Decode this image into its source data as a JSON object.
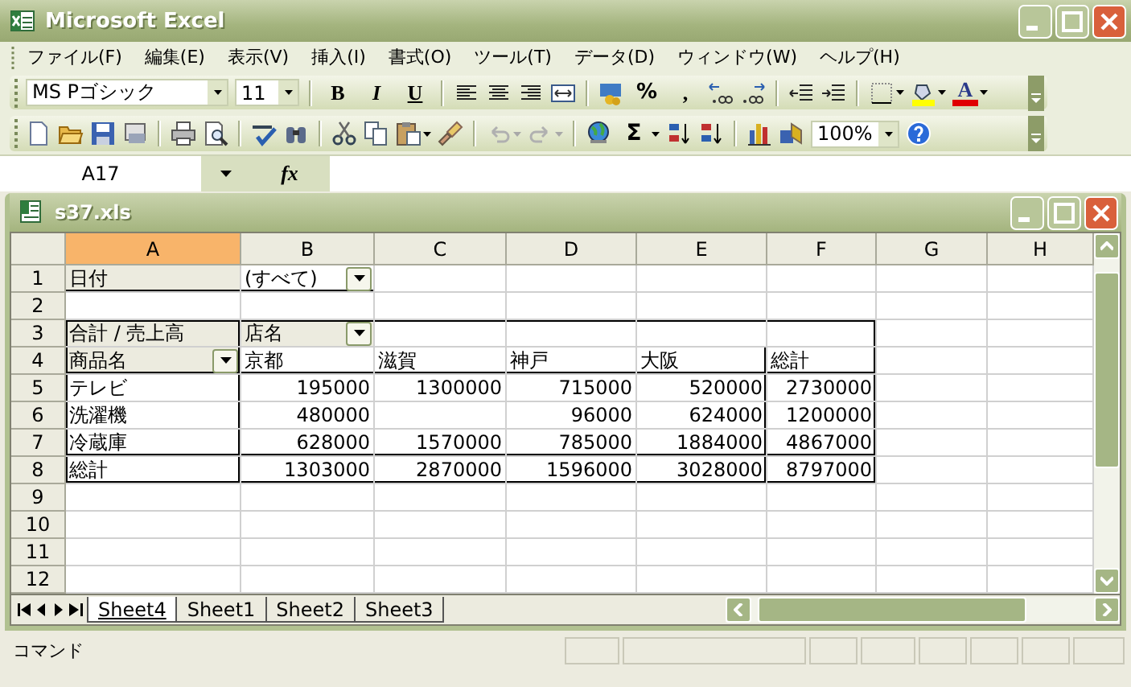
{
  "app": {
    "title": "Microsoft Excel"
  },
  "menu": [
    "ファイル(F)",
    "編集(E)",
    "表示(V)",
    "挿入(I)",
    "書式(O)",
    "ツール(T)",
    "データ(D)",
    "ウィンドウ(W)",
    "ヘルプ(H)"
  ],
  "formatting_toolbar": {
    "font": "MS Pゴシック",
    "font_size": "11",
    "bold": "B",
    "italic": "I",
    "underline": "U",
    "percent": "%",
    "comma": ",",
    "font_color": "A"
  },
  "standard_toolbar": {
    "undo": {
      "disabled": true
    },
    "redo": {
      "disabled": true
    },
    "autosum": "Σ",
    "zoom": "100%"
  },
  "formula_bar": {
    "name_box": "A17",
    "function_label": "fx"
  },
  "workbook": {
    "title": "s37.xls",
    "columns": [
      {
        "label": "A",
        "selected": true
      },
      {
        "label": "B",
        "selected": false
      },
      {
        "label": "C",
        "selected": false
      },
      {
        "label": "D",
        "selected": false
      },
      {
        "label": "E",
        "selected": false
      },
      {
        "label": "F",
        "selected": false
      },
      {
        "label": "G",
        "selected": false
      },
      {
        "label": "H",
        "selected": false
      }
    ],
    "rows": [
      {
        "number": "1",
        "cells": [
          {
            "kind": "field",
            "text": "日付"
          },
          {
            "kind": "filter",
            "text": "(すべて)"
          }
        ]
      },
      {
        "number": "2",
        "cells": []
      },
      {
        "number": "3",
        "cells": [
          {
            "kind": "field",
            "text": "合計 / 売上高"
          },
          {
            "kind": "field-dropdown",
            "text": "店名"
          }
        ]
      },
      {
        "number": "4",
        "cells": [
          {
            "kind": "field-dropdown",
            "text": "商品名"
          },
          {
            "kind": "text",
            "text": "京都"
          },
          {
            "kind": "text",
            "text": "滋賀"
          },
          {
            "kind": "text",
            "text": "神戸"
          },
          {
            "kind": "text",
            "text": "大阪"
          },
          {
            "kind": "text",
            "text": "総計"
          }
        ]
      },
      {
        "number": "5",
        "cells": [
          {
            "kind": "text",
            "text": "テレビ"
          },
          {
            "kind": "number",
            "text": "195000"
          },
          {
            "kind": "number",
            "text": "1300000"
          },
          {
            "kind": "number",
            "text": "715000"
          },
          {
            "kind": "number",
            "text": "520000"
          },
          {
            "kind": "number",
            "text": "2730000"
          }
        ]
      },
      {
        "number": "6",
        "cells": [
          {
            "kind": "text",
            "text": "洗濯機"
          },
          {
            "kind": "number",
            "text": "480000"
          },
          "",
          {
            "kind": "number",
            "text": "96000"
          },
          {
            "kind": "number",
            "text": "624000"
          },
          {
            "kind": "number",
            "text": "1200000"
          }
        ]
      },
      {
        "number": "7",
        "cells": [
          {
            "kind": "text",
            "text": "冷蔵庫"
          },
          {
            "kind": "number",
            "text": "628000"
          },
          {
            "kind": "number",
            "text": "1570000"
          },
          {
            "kind": "number",
            "text": "785000"
          },
          {
            "kind": "number",
            "text": "1884000"
          },
          {
            "kind": "number",
            "text": "4867000"
          }
        ]
      },
      {
        "number": "8",
        "cells": [
          {
            "kind": "text",
            "text": "総計"
          },
          {
            "kind": "number",
            "text": "1303000"
          },
          {
            "kind": "number",
            "text": "2870000"
          },
          {
            "kind": "number",
            "text": "1596000"
          },
          {
            "kind": "number",
            "text": "3028000"
          },
          {
            "kind": "number",
            "text": "8797000"
          }
        ]
      },
      {
        "number": "9",
        "cells": []
      },
      {
        "number": "10",
        "cells": []
      },
      {
        "number": "11",
        "cells": []
      },
      {
        "number": "12",
        "cells": []
      }
    ],
    "sheet_tabs": [
      {
        "label": "Sheet4",
        "selected": true
      },
      {
        "label": "Sheet1",
        "selected": false
      },
      {
        "label": "Sheet2",
        "selected": false
      },
      {
        "label": "Sheet3",
        "selected": false
      }
    ]
  },
  "status_bar": {
    "text": "コマンド"
  }
}
